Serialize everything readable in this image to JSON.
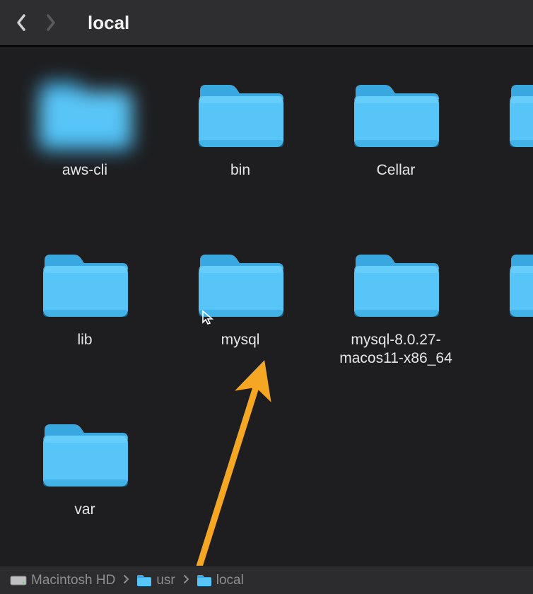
{
  "toolbar": {
    "title": "local"
  },
  "folders": [
    {
      "name": "aws-cli",
      "blurry": true
    },
    {
      "name": "bin"
    },
    {
      "name": "Cellar"
    },
    {
      "name": ""
    },
    {
      "name": "lib"
    },
    {
      "name": "mysql"
    },
    {
      "name": "mysql-8.0.27-macos11-x86_64"
    },
    {
      "name": ""
    },
    {
      "name": "var"
    }
  ],
  "path": {
    "segments": [
      {
        "label": "Macintosh HD",
        "icon": "hd"
      },
      {
        "label": "usr",
        "icon": "folder"
      },
      {
        "label": "local",
        "icon": "folder"
      }
    ]
  },
  "colors": {
    "folder": "#57c5f7",
    "folder_tab": "#3aa8e0",
    "annotation_arrow": "#f5a623"
  }
}
